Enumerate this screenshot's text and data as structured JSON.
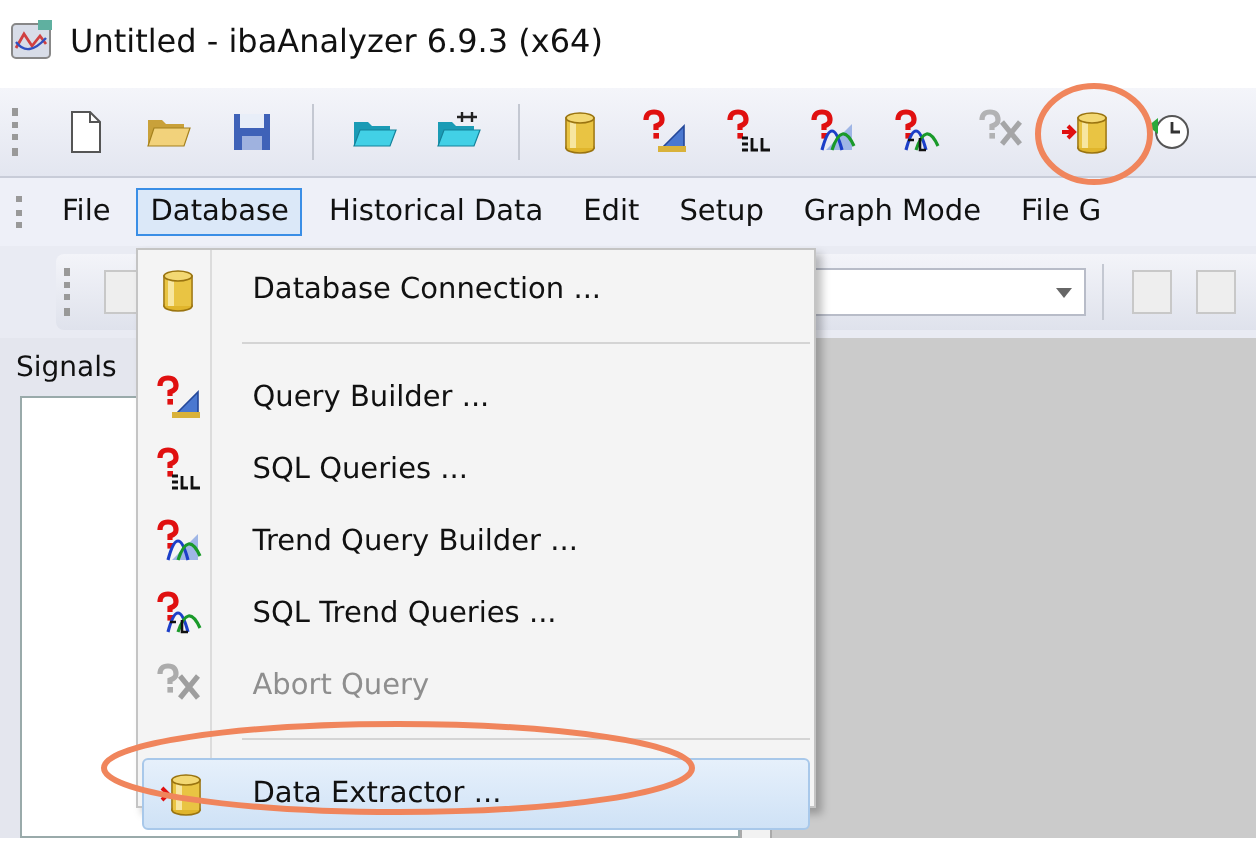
{
  "window": {
    "title": "Untitled - ibaAnalyzer 6.9.3 (x64)"
  },
  "toolbar": [
    {
      "kind": "button",
      "disabled": false
    },
    {
      "kind": "button",
      "disabled": false
    },
    {
      "kind": "button",
      "disabled": false
    },
    {
      "kind": "separator"
    },
    {
      "kind": "button",
      "disabled": false
    },
    {
      "kind": "button",
      "disabled": false
    },
    {
      "kind": "separator"
    },
    {
      "kind": "button",
      "disabled": false
    },
    {
      "kind": "button",
      "disabled": false
    },
    {
      "kind": "button",
      "disabled": false
    },
    {
      "kind": "button",
      "disabled": false
    },
    {
      "kind": "button",
      "disabled": false
    },
    {
      "kind": "button",
      "disabled": true
    },
    {
      "kind": "button",
      "disabled": false
    },
    {
      "kind": "button",
      "disabled": false
    }
  ],
  "menubar": [
    {
      "label": "File",
      "selected": false
    },
    {
      "label": "Database",
      "selected": true
    },
    {
      "label": "Historical Data",
      "selected": false
    },
    {
      "label": "Edit",
      "selected": false
    },
    {
      "label": "Setup",
      "selected": false
    },
    {
      "label": "Graph Mode",
      "selected": false
    },
    {
      "label": "File G",
      "selected": false
    }
  ],
  "menu": [
    {
      "kind": "item",
      "label": "Database Connection ...",
      "disabled": false,
      "selected": false
    },
    {
      "kind": "separator"
    },
    {
      "kind": "item",
      "label": "Query Builder ...",
      "disabled": false,
      "selected": false
    },
    {
      "kind": "item",
      "label": "SQL Queries ...",
      "disabled": false,
      "selected": false
    },
    {
      "kind": "item",
      "label": "Trend Query Builder ...",
      "disabled": false,
      "selected": false
    },
    {
      "kind": "item",
      "label": "SQL Trend Queries ...",
      "disabled": false,
      "selected": false
    },
    {
      "kind": "item",
      "label": "Abort Query",
      "disabled": true,
      "selected": false
    },
    {
      "kind": "separator"
    },
    {
      "kind": "item",
      "label": "Data Extractor ...",
      "disabled": false,
      "selected": true
    }
  ],
  "signals_panel": {
    "tab": "Signals"
  }
}
